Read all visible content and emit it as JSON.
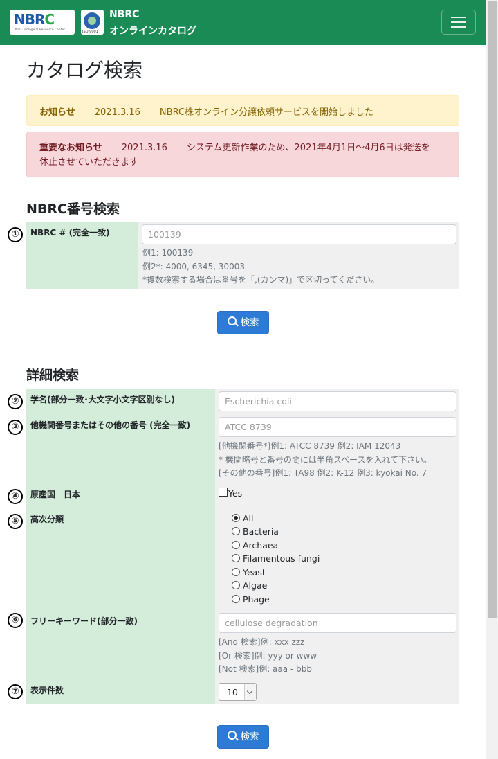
{
  "header": {
    "logo_text": "NBRC",
    "logo_subtext": "NITE Biological Resource Center",
    "iso_text": "ISO 9001",
    "brand_line1": "NBRC",
    "brand_line2": "オンラインカタログ",
    "accent_color": "#1b8b55"
  },
  "page_title": "カタログ検索",
  "notices": {
    "info": {
      "label": "お知らせ",
      "date": "2021.3.16",
      "text": "NBRC株オンライン分譲依頼サービスを開始しました"
    },
    "important": {
      "label": "重要なお知らせ",
      "date": "2021.3.16",
      "text_line1": "システム更新作業のため、2021年4月1日〜4月6日は発送を",
      "text_line2": "休止させていただきます"
    }
  },
  "nbrc_search": {
    "heading": "NBRC番号検索",
    "marker": "①",
    "label": "NBRC # (完全一致)",
    "placeholder": "100139",
    "help": [
      "例1: 100139",
      "例2*: 4000, 6345, 30003",
      "*複数検索する場合は番号を「,(カンマ)」で区切ってください。"
    ],
    "button": "検索"
  },
  "detail_search": {
    "heading": "詳細検索",
    "fields": {
      "species": {
        "marker": "②",
        "label": "学名(部分一致･大文字小文字区別なし)",
        "placeholder": "Escherichia coli"
      },
      "other_number": {
        "marker": "③",
        "label": "他機関番号またはその他の番号 (完全一致)",
        "placeholder": "ATCC 8739",
        "help": [
          "[他機関番号*]例1: ATCC 8739 例2: IAM 12043",
          "* 機関略号と番号の間には半角スペースを入れて下さい。",
          "[その他の番号]例1: TA98 例2: K-12 例3: kyokai No. 7"
        ]
      },
      "origin": {
        "marker": "④",
        "label": "原産国　日本",
        "checkbox_label": "Yes"
      },
      "taxonomy": {
        "marker": "⑤",
        "label": "高次分類",
        "options": [
          "All",
          "Bacteria",
          "Archaea",
          "Filamentous fungi",
          "Yeast",
          "Algae",
          "Phage"
        ],
        "selected": "All"
      },
      "keyword": {
        "marker": "⑥",
        "label": "フリーキーワード(部分一致)",
        "placeholder": "cellulose degradation",
        "help": [
          "[And 検索]例: xxx zzz",
          "[Or 検索]例: yyy or www",
          "[Not 検索]例: aaa - bbb"
        ]
      },
      "page_size": {
        "marker": "⑦",
        "label": "表示件数",
        "value": "10"
      }
    },
    "button": "検索"
  }
}
